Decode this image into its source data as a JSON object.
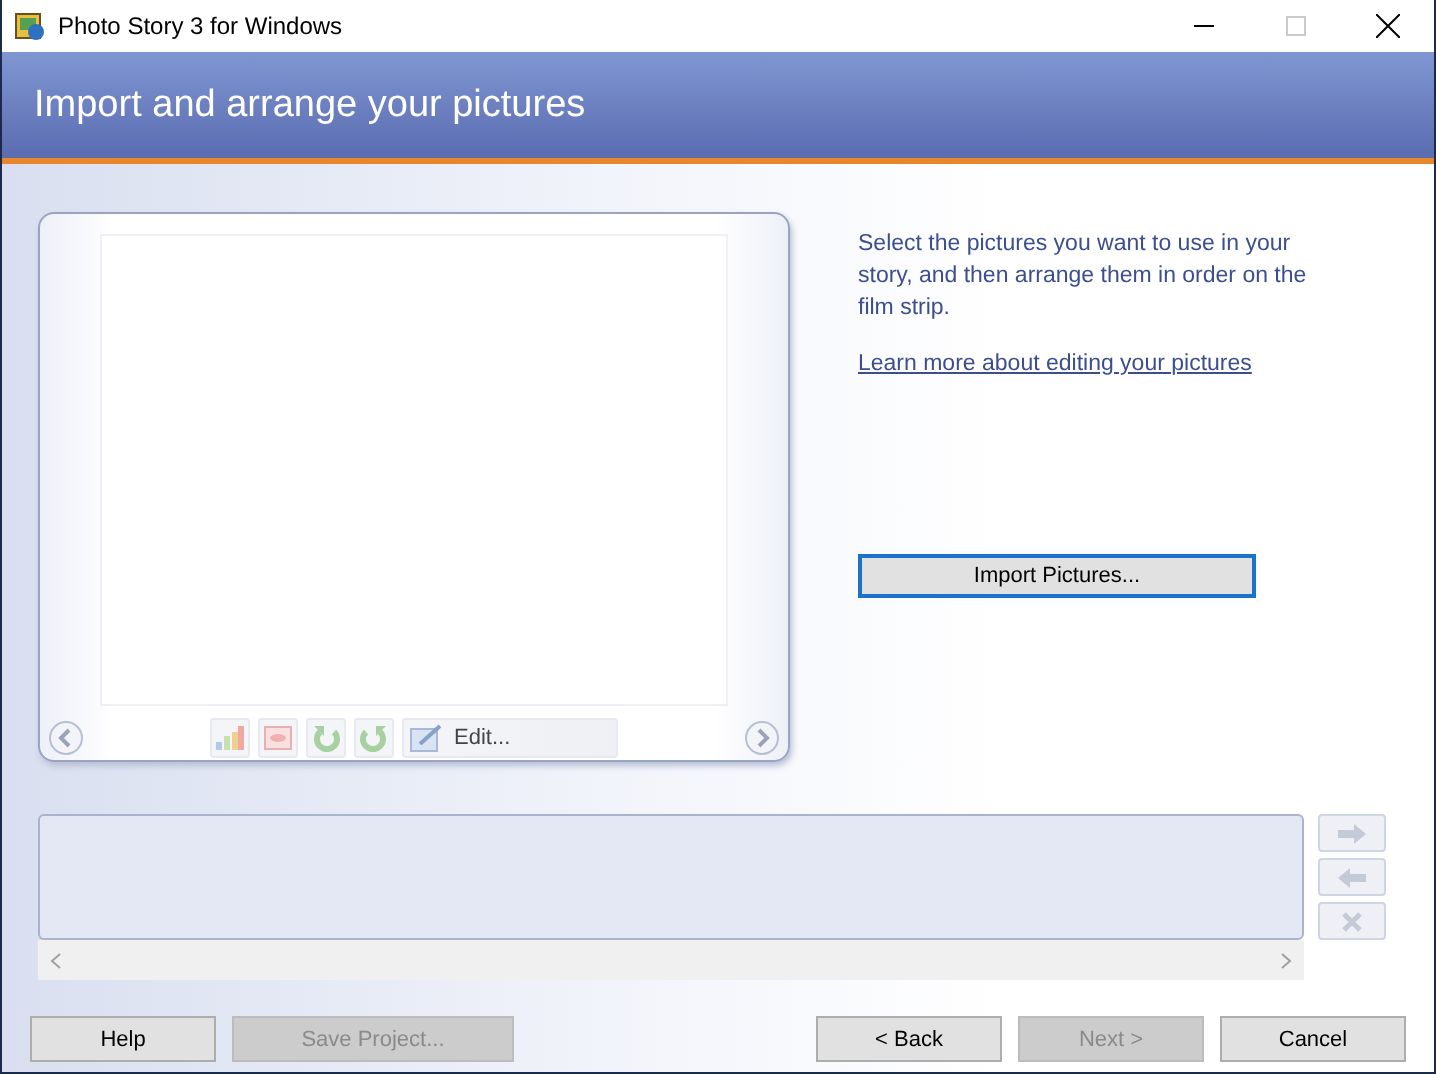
{
  "window": {
    "title": "Photo Story 3 for Windows"
  },
  "header": {
    "title": "Import and arrange your pictures"
  },
  "preview": {
    "edit_button": "Edit..."
  },
  "instructions": {
    "text": "Select the pictures you want to use in your story, and then arrange them in order on the film strip.",
    "link": "Learn more about editing your pictures"
  },
  "import_button": "Import Pictures...",
  "footer_buttons": [
    {
      "label": "Help",
      "disabled": false
    },
    {
      "label": "Save Project...",
      "disabled": true
    },
    {
      "label": "< Back",
      "disabled": false
    },
    {
      "label": "Next >",
      "disabled": true
    },
    {
      "label": "Cancel",
      "disabled": false
    }
  ]
}
